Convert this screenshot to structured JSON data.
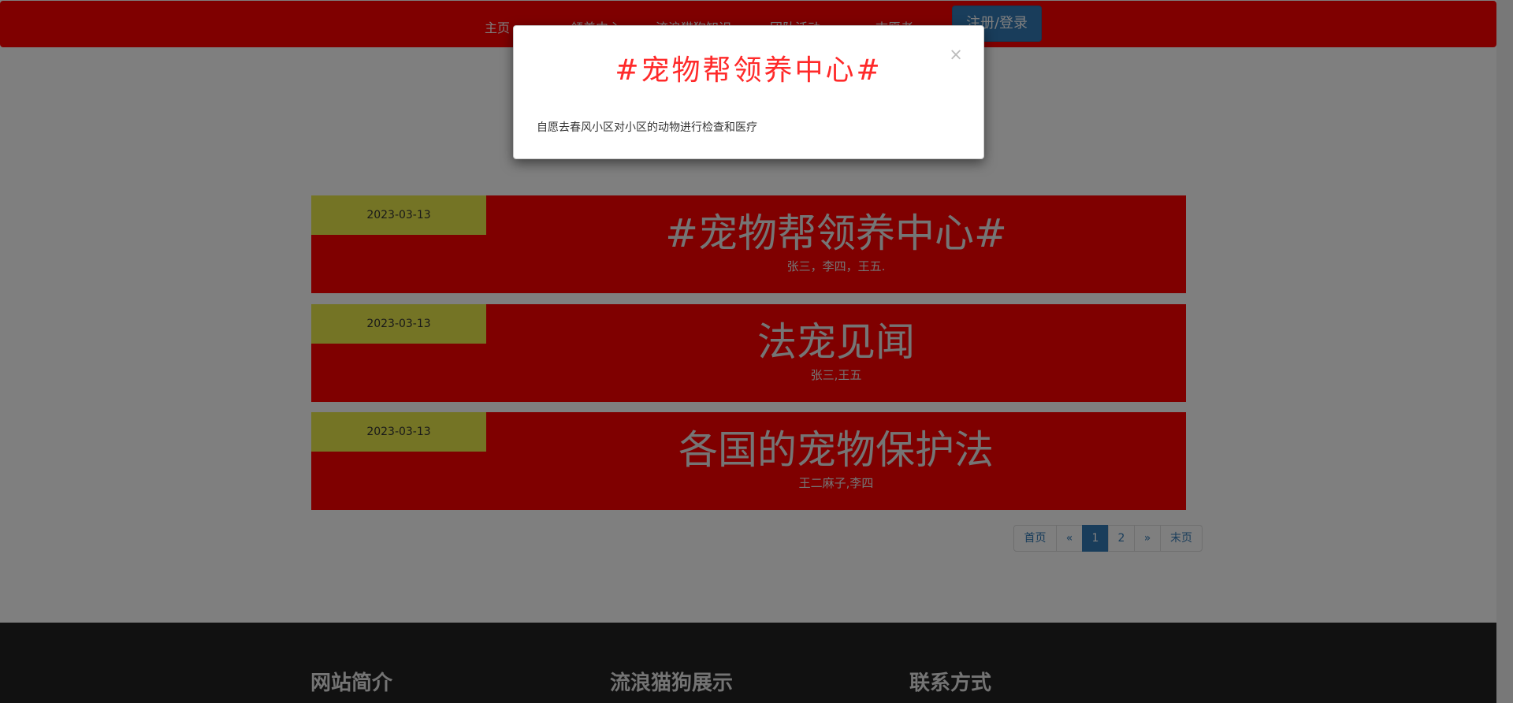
{
  "nav": {
    "items": [
      "主页",
      "领养中心",
      "流浪猫狗知识",
      "团队活动",
      "志愿者"
    ],
    "login_label": "注册/登录"
  },
  "news": [
    {
      "date": "2023-03-13",
      "title": "#宠物帮领养中心#",
      "authors": "张三，李四，王五."
    },
    {
      "date": "2023-03-13",
      "title": "法宠见闻",
      "authors": "张三,王五"
    },
    {
      "date": "2023-03-13",
      "title": "各国的宠物保护法",
      "authors": "王二麻子,李四"
    }
  ],
  "pagination": {
    "first": "首页",
    "prev": "«",
    "pages": [
      "1",
      "2"
    ],
    "next": "»",
    "last": "末页",
    "current": "1"
  },
  "footer": {
    "headings": [
      "网站简介",
      "流浪猫狗展示",
      "联系方式"
    ]
  },
  "modal": {
    "title": "#宠物帮领养中心#",
    "close_icon": "×",
    "body": "自愿去春风小区对小区的动物进行检查和医疗"
  },
  "colors": {
    "navbar": "#ff0000",
    "news_bg": "#ff0000",
    "date_bg": "#e8e84a",
    "primary": "#337ab7",
    "footer_bg": "#222222",
    "modal_title": "#ff2a2a"
  }
}
